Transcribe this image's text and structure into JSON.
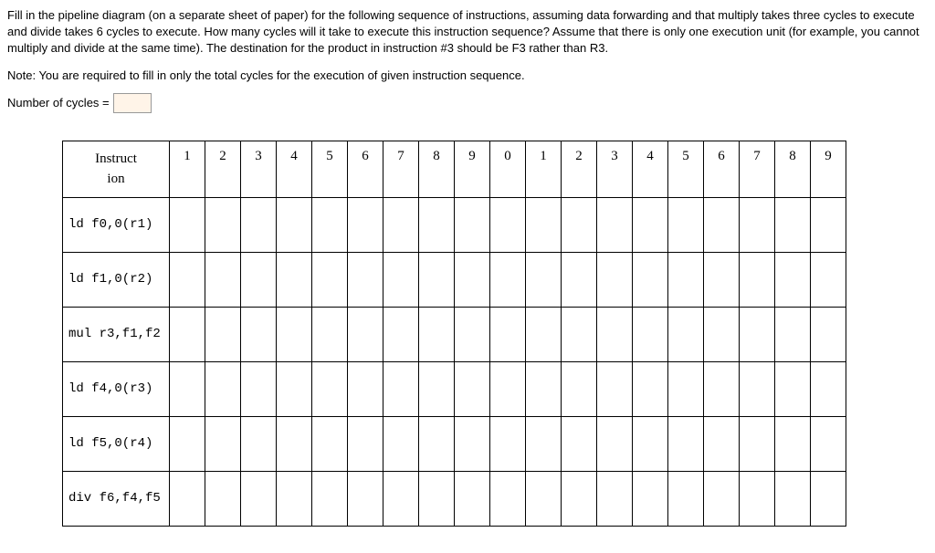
{
  "question": {
    "para1": "Fill in the pipeline diagram (on a separate sheet of paper) for the following sequence of instructions, assuming data forwarding and that multiply takes three cycles to execute and divide takes 6 cycles to execute. How many cycles will it take to execute this instruction sequence? Assume that there is only one execution unit (for example, you cannot multiply and divide at the same time). The destination for the product in instruction #3 should be F3 rather than R3.",
    "note": "Note: You are required to fill in only the total cycles for the execution of given instruction sequence.",
    "cycles_label": "Number of cycles =",
    "cycles_value": ""
  },
  "table": {
    "inst_header_l1": "Instruct",
    "inst_header_l2": "ion",
    "cycle_headers": [
      "1",
      "2",
      "3",
      "4",
      "5",
      "6",
      "7",
      "8",
      "9",
      "0",
      "1",
      "2",
      "3",
      "4",
      "5",
      "6",
      "7",
      "8",
      "9"
    ],
    "instructions": [
      "ld  f0,0(r1)",
      "ld  f1,0(r2)",
      "mul r3,f1,f2",
      "ld  f4,0(r3)",
      "ld  f5,0(r4)",
      "div f6,f4,f5"
    ]
  }
}
